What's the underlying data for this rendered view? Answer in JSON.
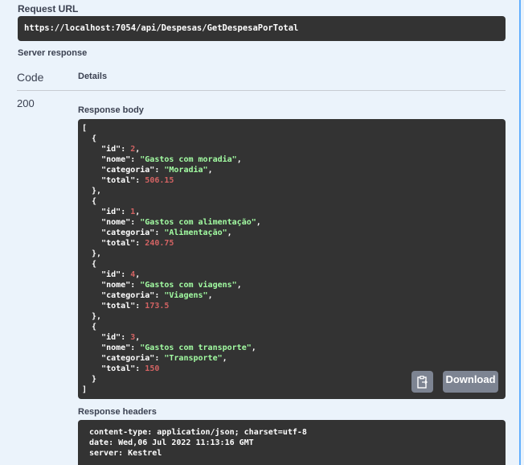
{
  "request": {
    "url_label": "Request URL",
    "url": "https://localhost:7054/api/Despesas/GetDespesaPorTotal"
  },
  "server_response": {
    "label": "Server response",
    "code_header": "Code",
    "details_header": "Details",
    "status_code": "200",
    "response_body_label": "Response body",
    "response_headers_label": "Response headers",
    "download_label": "Download",
    "items": [
      {
        "id": "2",
        "nome": "Gastos com moradia",
        "categoria": "Moradia",
        "total": "506.15"
      },
      {
        "id": "1",
        "nome": "Gastos com alimentação",
        "categoria": "Alimentação",
        "total": "240.75"
      },
      {
        "id": "4",
        "nome": "Gastos com viagens",
        "categoria": "Viagens",
        "total": "173.5"
      },
      {
        "id": "3",
        "nome": "Gastos com transporte",
        "categoria": "Transporte",
        "total": "150"
      }
    ],
    "headers": [
      "content-type: application/json; charset=utf-8",
      "date: Wed,06 Jul 2022 11:13:16 GMT",
      "server: Kestrel"
    ]
  },
  "icons": {
    "copy": "clipboard-icon"
  },
  "colors": {
    "background": "#ebf3fb",
    "code_block": "#333333",
    "string": "#a2fca2",
    "number": "#d36363",
    "button": "#7d8492",
    "accent_border": "#61affe"
  }
}
